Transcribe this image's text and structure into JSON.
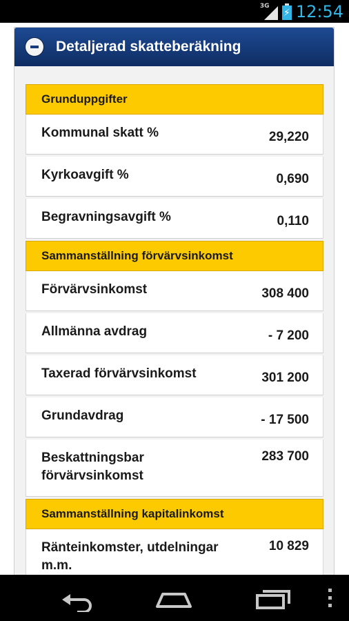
{
  "status_bar": {
    "network_type": "3G",
    "time": "12:54",
    "battery_color": "#33b5e5",
    "icons": [
      "signal-icon",
      "battery-charging-icon"
    ]
  },
  "panel": {
    "title": "Detaljerad skatteberäkning",
    "header_color": "#163a7a",
    "collapse_icon": "minus-circle-icon"
  },
  "sections": [
    {
      "title": "Grunduppgifter",
      "rows": [
        {
          "label": "Kommunal skatt %",
          "value": "29,220"
        },
        {
          "label": "Kyrkoavgift %",
          "value": "0,690"
        },
        {
          "label": "Begravningsavgift %",
          "value": "0,110"
        }
      ]
    },
    {
      "title": "Sammanställning förvärvsinkomst",
      "rows": [
        {
          "label": "Förvärvsinkomst",
          "value": "308 400"
        },
        {
          "label": "Allmänna avdrag",
          "value": "- 7 200"
        },
        {
          "label": "Taxerad förvärvsinkomst",
          "value": "301 200"
        },
        {
          "label": "Grundavdrag",
          "value": "- 17 500"
        },
        {
          "label": "Beskattningsbar förvärvsinkomst",
          "value": "283 700"
        }
      ]
    },
    {
      "title": "Sammanställning kapitalinkomst",
      "rows": [
        {
          "label": "Ränteinkomster, utdelningar m.m.",
          "value": "10 829"
        }
      ]
    }
  ],
  "section_color": "#fdca00",
  "nav_bar": {
    "icons": [
      "back-icon",
      "home-icon",
      "recent-apps-icon",
      "overflow-menu-icon"
    ]
  }
}
